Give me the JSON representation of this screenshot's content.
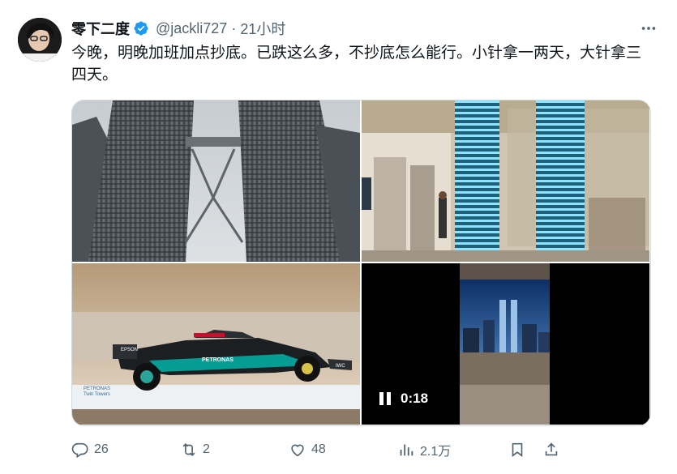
{
  "tweet": {
    "display_name": "零下二度",
    "handle": "@jackli727",
    "separator": "·",
    "time": "21小时",
    "text": "今晚，明晚加班加点抄底。已跌这么多，不抄底怎么能行。小针拿一两天，大针拿三四天。",
    "verified": true
  },
  "media": {
    "images": [
      {
        "description_icon": "twin-towers-photo"
      },
      {
        "description_icon": "tower-models-mall-photo"
      },
      {
        "description_icon": "f1-car-display-photo"
      },
      {
        "description_icon": "city-video"
      }
    ],
    "video": {
      "duration": "0:18",
      "state": "paused-icon"
    },
    "f1_display": {
      "sponsor": "PETRONAS",
      "sign_line1": "PETRONAS",
      "sign_line2": "Twin Towers",
      "side_text": "EPSON",
      "number": "IWC"
    }
  },
  "actions": {
    "reply_count": "26",
    "retweet_count": "2",
    "like_count": "48",
    "views_count": "2.1万"
  },
  "colors": {
    "text_primary": "#0f1419",
    "text_secondary": "#536471",
    "verified_blue": "#1d9bf0",
    "border": "#cfd9de"
  }
}
